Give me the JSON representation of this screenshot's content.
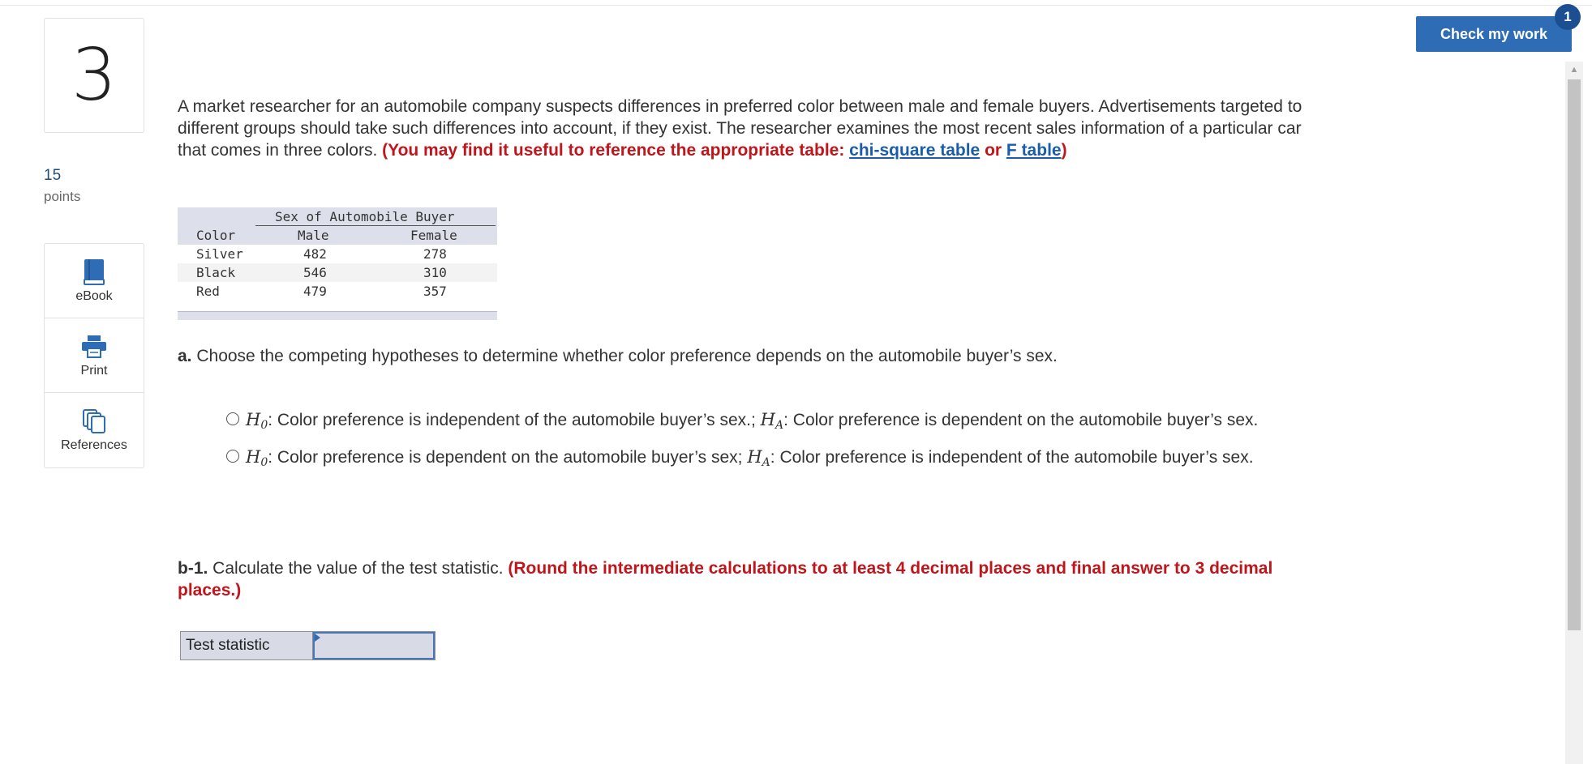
{
  "question": {
    "number": "3",
    "points_value": "15",
    "points_label": "points"
  },
  "tools": [
    {
      "label": "eBook",
      "icon": "book-icon"
    },
    {
      "label": "Print",
      "icon": "printer-icon"
    },
    {
      "label": "References",
      "icon": "copy-icon"
    }
  ],
  "header": {
    "check_label": "Check my work",
    "badge_count": "1"
  },
  "prompt": {
    "text": "A market researcher for an automobile company suspects differences in preferred color between male and female buyers. Advertisements targeted to different groups should take such differences into account, if they exist. The researcher examines the most recent sales information of a particular car that comes in three colors.",
    "note_prefix": "(You may find it useful to reference the appropriate table: ",
    "link1": "chi-square table",
    "link_or": " or ",
    "link2": "F table",
    "note_suffix": ")"
  },
  "table": {
    "span_header": "Sex of Automobile Buyer",
    "col_color": "Color",
    "col_male": "Male",
    "col_female": "Female",
    "rows": [
      {
        "color": "Silver",
        "male": "482",
        "female": "278"
      },
      {
        "color": "Black",
        "male": "546",
        "female": "310"
      },
      {
        "color": "Red",
        "male": "479",
        "female": "357"
      }
    ]
  },
  "part_a": {
    "label": "a.",
    "text": " Choose the competing hypotheses to determine whether color preference depends on the automobile buyer’s sex."
  },
  "options": [
    {
      "h0": "H",
      "h0_sub": "0",
      "h0_text": ": Color preference is independent of the automobile buyer’s sex.; ",
      "ha": "H",
      "ha_sub": "A",
      "ha_text": ": Color preference is dependent on the automobile buyer’s sex."
    },
    {
      "h0": "H",
      "h0_sub": "0",
      "h0_text": ": Color preference is dependent on the automobile buyer’s sex; ",
      "ha": "H",
      "ha_sub": "A",
      "ha_text": ": Color preference is independent of the automobile buyer’s sex."
    }
  ],
  "part_b1": {
    "label": "b-1.",
    "text": " Calculate the value of the test statistic. ",
    "note": "(Round the intermediate calculations to at least 4 decimal places and final answer to 3 decimal places.)"
  },
  "answer": {
    "label": "Test statistic",
    "value": ""
  }
}
